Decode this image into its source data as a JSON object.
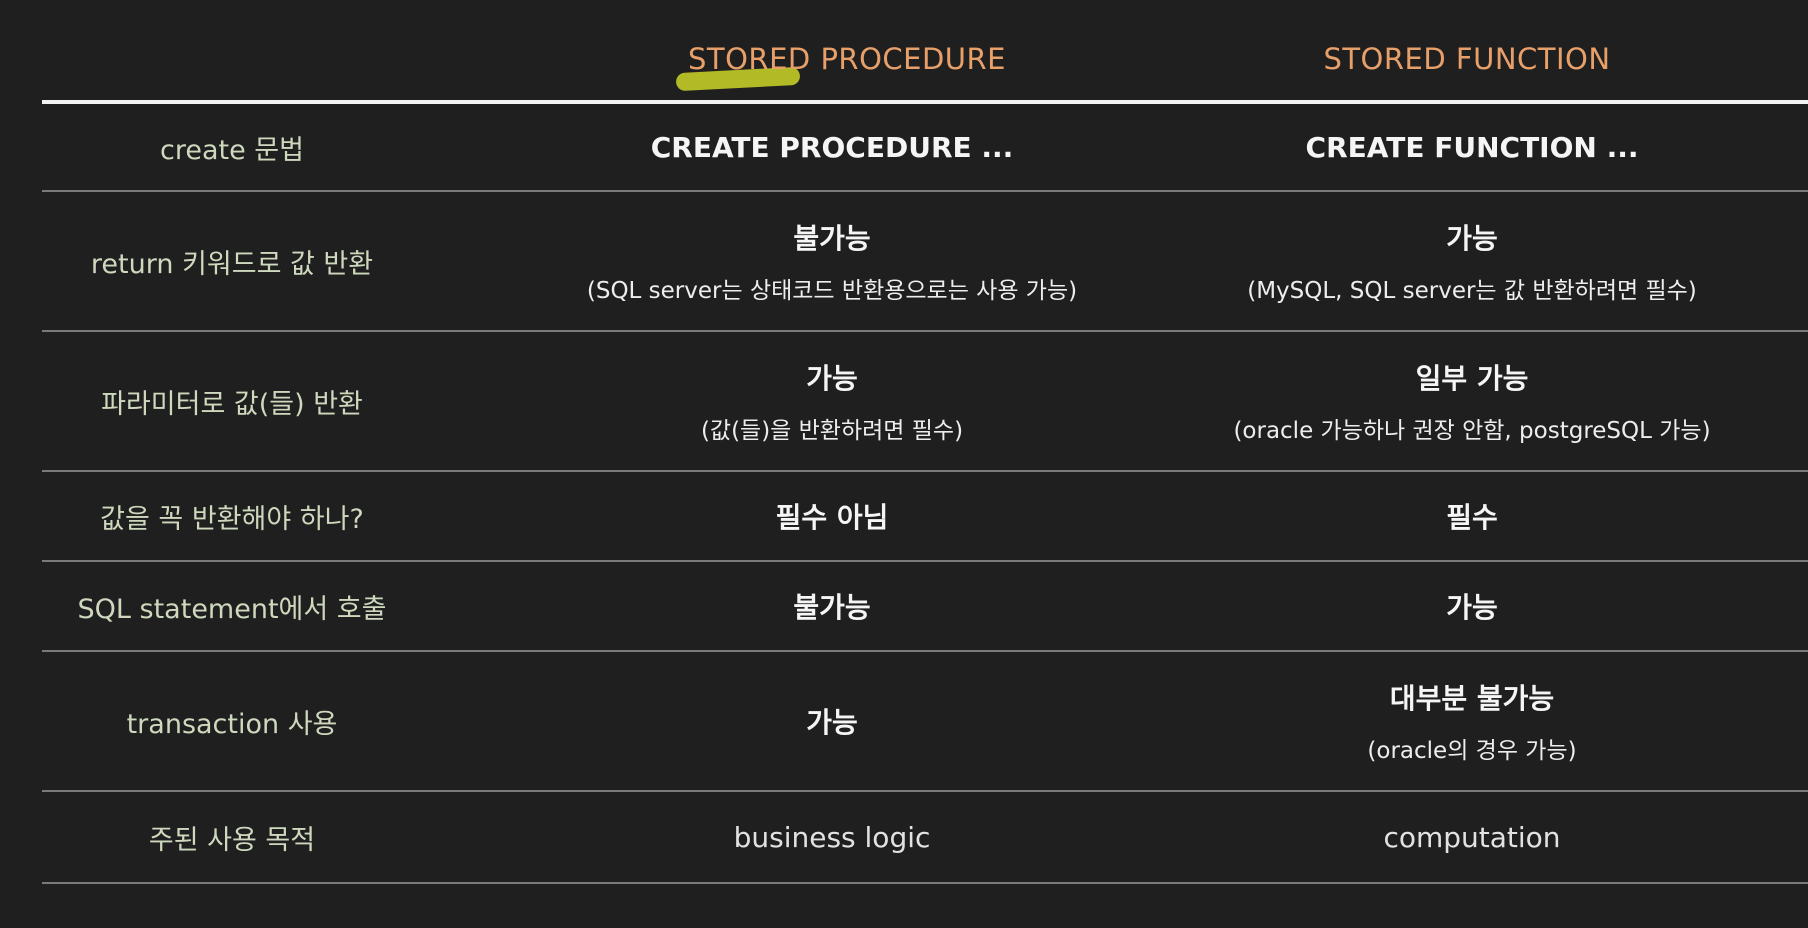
{
  "columns": {
    "procedure": "STORED PROCEDURE",
    "function": "STORED FUNCTION"
  },
  "rows": [
    {
      "label": "create 문법",
      "procedure": {
        "main": "CREATE PROCEDURE ...",
        "sub": ""
      },
      "function": {
        "main": "CREATE FUNCTION ...",
        "sub": ""
      }
    },
    {
      "label": "return 키워드로 값 반환",
      "procedure": {
        "main": "불가능",
        "sub": "(SQL server는 상태코드 반환용으로는 사용 가능)"
      },
      "function": {
        "main": "가능",
        "sub": "(MySQL, SQL server는 값 반환하려면 필수)"
      }
    },
    {
      "label": "파라미터로 값(들) 반환",
      "procedure": {
        "main": "가능",
        "sub": "(값(들)을 반환하려면 필수)"
      },
      "function": {
        "main": "일부 가능",
        "sub": "(oracle 가능하나 권장 안함, postgreSQL 가능)"
      }
    },
    {
      "label": "값을 꼭 반환해야 하나?",
      "procedure": {
        "main": "필수 아님",
        "sub": ""
      },
      "function": {
        "main": "필수",
        "sub": ""
      }
    },
    {
      "label": "SQL statement에서 호출",
      "procedure": {
        "main": "불가능",
        "sub": ""
      },
      "function": {
        "main": "가능",
        "sub": ""
      }
    },
    {
      "label": "transaction 사용",
      "procedure": {
        "main": "가능",
        "sub": ""
      },
      "function": {
        "main": "대부분 불가능",
        "sub": "(oracle의 경우 가능)"
      }
    },
    {
      "label": "주된 사용 목적",
      "procedure": {
        "main": "business logic",
        "sub": ""
      },
      "function": {
        "main": "computation",
        "sub": ""
      }
    }
  ],
  "colors": {
    "background": "#1f1f1f",
    "header_text": "#e8a06a",
    "highlighter": "#cdd728",
    "row_label": "#cdd8bd",
    "rule": "#7a7a7a"
  }
}
